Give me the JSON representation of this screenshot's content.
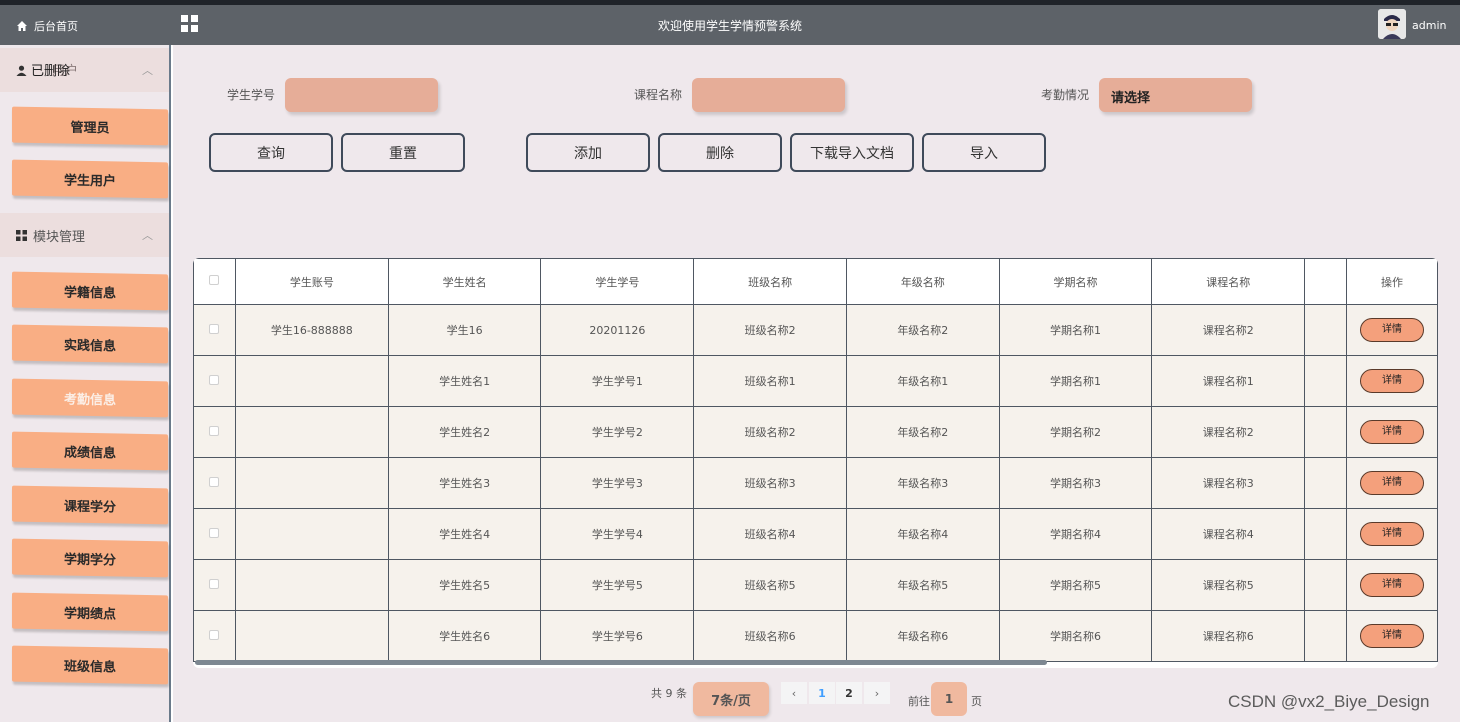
{
  "topbar": {
    "home_label": "后台首页",
    "title": "欢迎使用学生学情预警系统",
    "user": "admin"
  },
  "sidebar": {
    "group1": {
      "label_overlap": "已删除",
      "label_tail": "用户",
      "icon": "user-icon"
    },
    "group1_items": [
      {
        "label": "管理员"
      },
      {
        "label": "学生用户"
      }
    ],
    "group2": {
      "label": "模块管理",
      "icon": "grid-icon"
    },
    "group2_items": [
      {
        "label": "学籍信息"
      },
      {
        "label": "实践信息"
      },
      {
        "label": "考勤信息",
        "active": true
      },
      {
        "label": "成绩信息"
      },
      {
        "label": "课程学分"
      },
      {
        "label": "学期学分"
      },
      {
        "label": "学期绩点"
      },
      {
        "label": "班级信息"
      }
    ]
  },
  "filters": {
    "student_no_label": "学生学号",
    "course_label": "课程名称",
    "attendance_label": "考勤情况",
    "attendance_value": "请选择"
  },
  "buttons": {
    "query": "查询",
    "reset": "重置",
    "add": "添加",
    "delete": "删除",
    "download": "下载导入文档",
    "import": "导入"
  },
  "table": {
    "headers": [
      "学生账号",
      "学生姓名",
      "学生学号",
      "班级名称",
      "年级名称",
      "学期名称",
      "课程名称",
      "",
      "操作"
    ],
    "detail_label": "详情",
    "rows": [
      [
        "学生16-888888",
        "学生16",
        "20201126",
        "班级名称2",
        "年级名称2",
        "学期名称1",
        "课程名称2"
      ],
      [
        "",
        "学生姓名1",
        "学生学号1",
        "班级名称1",
        "年级名称1",
        "学期名称1",
        "课程名称1"
      ],
      [
        "",
        "学生姓名2",
        "学生学号2",
        "班级名称2",
        "年级名称2",
        "学期名称2",
        "课程名称2"
      ],
      [
        "",
        "学生姓名3",
        "学生学号3",
        "班级名称3",
        "年级名称3",
        "学期名称3",
        "课程名称3"
      ],
      [
        "",
        "学生姓名4",
        "学生学号4",
        "班级名称4",
        "年级名称4",
        "学期名称4",
        "课程名称4"
      ],
      [
        "",
        "学生姓名5",
        "学生学号5",
        "班级名称5",
        "年级名称5",
        "学期名称5",
        "课程名称5"
      ],
      [
        "",
        "学生姓名6",
        "学生学号6",
        "班级名称6",
        "年级名称6",
        "学期名称6",
        "课程名称6"
      ]
    ]
  },
  "pagination": {
    "total": "共 9 条",
    "page_size": "7条/页",
    "pages": [
      "1",
      "2"
    ],
    "current": "1",
    "prev": "‹",
    "next": "›",
    "goto_prefix": "前往",
    "goto_value": "1",
    "goto_suffix": "页"
  },
  "watermark": "CSDN @vx2_Biye_Design",
  "colors": {
    "accent": "#f9ae84",
    "topbar": "#5d6268",
    "bg": "#efe8ec"
  }
}
